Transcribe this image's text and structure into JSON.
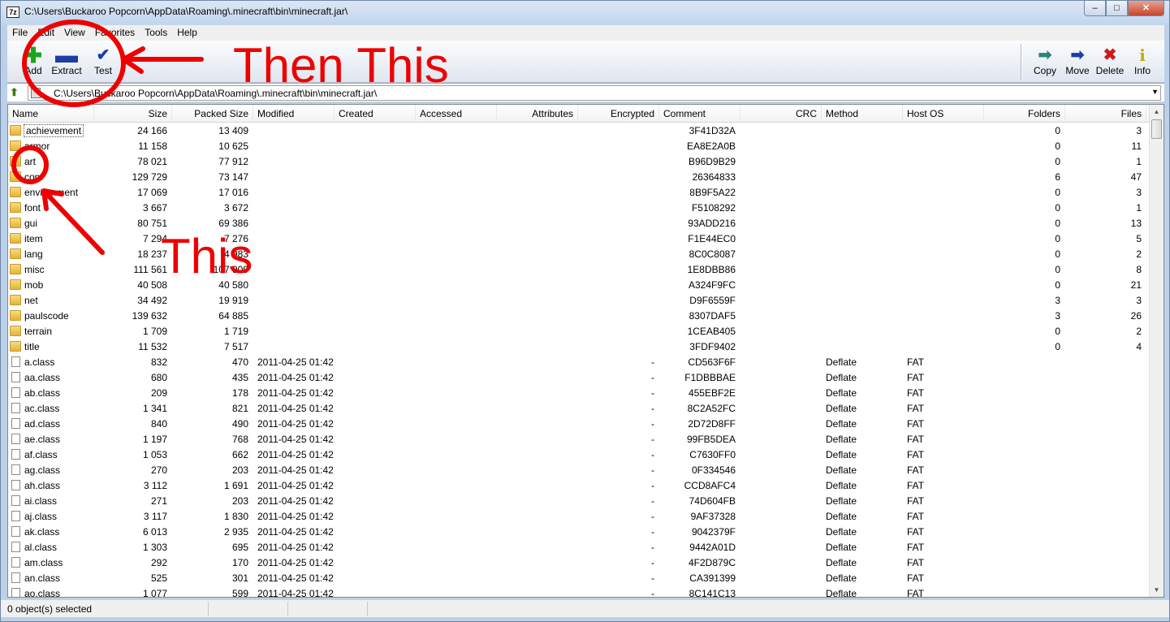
{
  "window": {
    "title": "C:\\Users\\Buckaroo Popcorn\\AppData\\Roaming\\.minecraft\\bin\\minecraft.jar\\",
    "app_icon_text": "7z",
    "min_label": "–",
    "max_label": "□",
    "close_label": "✕"
  },
  "menu": [
    "File",
    "Edit",
    "View",
    "Favorites",
    "Tools",
    "Help"
  ],
  "toolbar": {
    "add": "Add",
    "extract": "Extract",
    "test": "Test",
    "copy": "Copy",
    "move": "Move",
    "delete": "Delete",
    "info": "Info",
    "icons": {
      "add": "plus-icon",
      "extract": "minus-icon",
      "test": "check-icon",
      "copy": "arrow-right-icon",
      "move": "arrow-right-icon",
      "delete": "x-icon",
      "info": "info-icon"
    },
    "colors": {
      "add": "#1aa51a",
      "extract": "#1d3da8",
      "copy": "#27857a",
      "move": "#1d3da8",
      "delete": "#d01818",
      "info": "#c8a800"
    }
  },
  "address": {
    "path": "C:\\Users\\Buckaroo Popcorn\\AppData\\Roaming\\.minecraft\\bin\\minecraft.jar\\"
  },
  "columns": {
    "name": "Name",
    "size": "Size",
    "packed": "Packed Size",
    "modified": "Modified",
    "created": "Created",
    "accessed": "Accessed",
    "attributes": "Attributes",
    "encrypted": "Encrypted",
    "comment": "Comment",
    "crc": "CRC",
    "method": "Method",
    "host": "Host OS",
    "folders": "Folders",
    "files": "Files"
  },
  "rows": [
    {
      "type": "folder",
      "name": "achievement",
      "size": "24 166",
      "packed": "13 409",
      "modified": "",
      "encrypted": "",
      "crc": "3F41D32A",
      "method": "",
      "host": "",
      "folders": "0",
      "files": "3"
    },
    {
      "type": "folder",
      "name": "armor",
      "size": "11 158",
      "packed": "10 625",
      "modified": "",
      "encrypted": "",
      "crc": "EA8E2A0B",
      "method": "",
      "host": "",
      "folders": "0",
      "files": "11"
    },
    {
      "type": "folder",
      "name": "art",
      "size": "78 021",
      "packed": "77 912",
      "modified": "",
      "encrypted": "",
      "crc": "B96D9B29",
      "method": "",
      "host": "",
      "folders": "0",
      "files": "1"
    },
    {
      "type": "folder",
      "name": "com",
      "size": "129 729",
      "packed": "73 147",
      "modified": "",
      "encrypted": "",
      "crc": "26364833",
      "method": "",
      "host": "",
      "folders": "6",
      "files": "47"
    },
    {
      "type": "folder",
      "name": "environment",
      "size": "17 069",
      "packed": "17 016",
      "modified": "",
      "encrypted": "",
      "crc": "8B9F5A22",
      "method": "",
      "host": "",
      "folders": "0",
      "files": "3"
    },
    {
      "type": "folder",
      "name": "font",
      "size": "3 667",
      "packed": "3 672",
      "modified": "",
      "encrypted": "",
      "crc": "F5108292",
      "method": "",
      "host": "",
      "folders": "0",
      "files": "1"
    },
    {
      "type": "folder",
      "name": "gui",
      "size": "80 751",
      "packed": "69 386",
      "modified": "",
      "encrypted": "",
      "crc": "93ADD216",
      "method": "",
      "host": "",
      "folders": "0",
      "files": "13"
    },
    {
      "type": "folder",
      "name": "item",
      "size": "7 294",
      "packed": "7 276",
      "modified": "",
      "encrypted": "",
      "crc": "F1E44EC0",
      "method": "",
      "host": "",
      "folders": "0",
      "files": "5"
    },
    {
      "type": "folder",
      "name": "lang",
      "size": "18 237",
      "packed": "4 983",
      "modified": "",
      "encrypted": "",
      "crc": "8C0C8087",
      "method": "",
      "host": "",
      "folders": "0",
      "files": "2"
    },
    {
      "type": "folder",
      "name": "misc",
      "size": "111 561",
      "packed": "107 909",
      "modified": "",
      "encrypted": "",
      "crc": "1E8DBB86",
      "method": "",
      "host": "",
      "folders": "0",
      "files": "8"
    },
    {
      "type": "folder",
      "name": "mob",
      "size": "40 508",
      "packed": "40 580",
      "modified": "",
      "encrypted": "",
      "crc": "A324F9FC",
      "method": "",
      "host": "",
      "folders": "0",
      "files": "21"
    },
    {
      "type": "folder",
      "name": "net",
      "size": "34 492",
      "packed": "19 919",
      "modified": "",
      "encrypted": "",
      "crc": "D9F6559F",
      "method": "",
      "host": "",
      "folders": "3",
      "files": "3"
    },
    {
      "type": "folder",
      "name": "paulscode",
      "size": "139 632",
      "packed": "64 885",
      "modified": "",
      "encrypted": "",
      "crc": "8307DAF5",
      "method": "",
      "host": "",
      "folders": "3",
      "files": "26"
    },
    {
      "type": "folder",
      "name": "terrain",
      "size": "1 709",
      "packed": "1 719",
      "modified": "",
      "encrypted": "",
      "crc": "1CEAB405",
      "method": "",
      "host": "",
      "folders": "0",
      "files": "2"
    },
    {
      "type": "folder",
      "name": "title",
      "size": "11 532",
      "packed": "7 517",
      "modified": "",
      "encrypted": "",
      "crc": "3FDF9402",
      "method": "",
      "host": "",
      "folders": "0",
      "files": "4"
    },
    {
      "type": "file",
      "name": "a.class",
      "size": "832",
      "packed": "470",
      "modified": "2011-04-25 01:42",
      "encrypted": "-",
      "crc": "CD563F6F",
      "method": "Deflate",
      "host": "FAT",
      "folders": "",
      "files": ""
    },
    {
      "type": "file",
      "name": "aa.class",
      "size": "680",
      "packed": "435",
      "modified": "2011-04-25 01:42",
      "encrypted": "-",
      "crc": "F1DBBBAE",
      "method": "Deflate",
      "host": "FAT",
      "folders": "",
      "files": ""
    },
    {
      "type": "file",
      "name": "ab.class",
      "size": "209",
      "packed": "178",
      "modified": "2011-04-25 01:42",
      "encrypted": "-",
      "crc": "455EBF2E",
      "method": "Deflate",
      "host": "FAT",
      "folders": "",
      "files": ""
    },
    {
      "type": "file",
      "name": "ac.class",
      "size": "1 341",
      "packed": "821",
      "modified": "2011-04-25 01:42",
      "encrypted": "-",
      "crc": "8C2A52FC",
      "method": "Deflate",
      "host": "FAT",
      "folders": "",
      "files": ""
    },
    {
      "type": "file",
      "name": "ad.class",
      "size": "840",
      "packed": "490",
      "modified": "2011-04-25 01:42",
      "encrypted": "-",
      "crc": "2D72D8FF",
      "method": "Deflate",
      "host": "FAT",
      "folders": "",
      "files": ""
    },
    {
      "type": "file",
      "name": "ae.class",
      "size": "1 197",
      "packed": "768",
      "modified": "2011-04-25 01:42",
      "encrypted": "-",
      "crc": "99FB5DEA",
      "method": "Deflate",
      "host": "FAT",
      "folders": "",
      "files": ""
    },
    {
      "type": "file",
      "name": "af.class",
      "size": "1 053",
      "packed": "662",
      "modified": "2011-04-25 01:42",
      "encrypted": "-",
      "crc": "C7630FF0",
      "method": "Deflate",
      "host": "FAT",
      "folders": "",
      "files": ""
    },
    {
      "type": "file",
      "name": "ag.class",
      "size": "270",
      "packed": "203",
      "modified": "2011-04-25 01:42",
      "encrypted": "-",
      "crc": "0F334546",
      "method": "Deflate",
      "host": "FAT",
      "folders": "",
      "files": ""
    },
    {
      "type": "file",
      "name": "ah.class",
      "size": "3 112",
      "packed": "1 691",
      "modified": "2011-04-25 01:42",
      "encrypted": "-",
      "crc": "CCD8AFC4",
      "method": "Deflate",
      "host": "FAT",
      "folders": "",
      "files": ""
    },
    {
      "type": "file",
      "name": "ai.class",
      "size": "271",
      "packed": "203",
      "modified": "2011-04-25 01:42",
      "encrypted": "-",
      "crc": "74D604FB",
      "method": "Deflate",
      "host": "FAT",
      "folders": "",
      "files": ""
    },
    {
      "type": "file",
      "name": "aj.class",
      "size": "3 117",
      "packed": "1 830",
      "modified": "2011-04-25 01:42",
      "encrypted": "-",
      "crc": "9AF37328",
      "method": "Deflate",
      "host": "FAT",
      "folders": "",
      "files": ""
    },
    {
      "type": "file",
      "name": "ak.class",
      "size": "6 013",
      "packed": "2 935",
      "modified": "2011-04-25 01:42",
      "encrypted": "-",
      "crc": "9042379F",
      "method": "Deflate",
      "host": "FAT",
      "folders": "",
      "files": ""
    },
    {
      "type": "file",
      "name": "al.class",
      "size": "1 303",
      "packed": "695",
      "modified": "2011-04-25 01:42",
      "encrypted": "-",
      "crc": "9442A01D",
      "method": "Deflate",
      "host": "FAT",
      "folders": "",
      "files": ""
    },
    {
      "type": "file",
      "name": "am.class",
      "size": "292",
      "packed": "170",
      "modified": "2011-04-25 01:42",
      "encrypted": "-",
      "crc": "4F2D879C",
      "method": "Deflate",
      "host": "FAT",
      "folders": "",
      "files": ""
    },
    {
      "type": "file",
      "name": "an.class",
      "size": "525",
      "packed": "301",
      "modified": "2011-04-25 01:42",
      "encrypted": "-",
      "crc": "CA391399",
      "method": "Deflate",
      "host": "FAT",
      "folders": "",
      "files": ""
    },
    {
      "type": "file",
      "name": "ao.class",
      "size": "1 077",
      "packed": "599",
      "modified": "2011-04-25 01:42",
      "encrypted": "-",
      "crc": "8C141C13",
      "method": "Deflate",
      "host": "FAT",
      "folders": "",
      "files": ""
    }
  ],
  "status": {
    "selected": "0 object(s) selected"
  },
  "annotations": {
    "then_this": "Then This",
    "this": "This",
    "color": "#ee0000"
  }
}
